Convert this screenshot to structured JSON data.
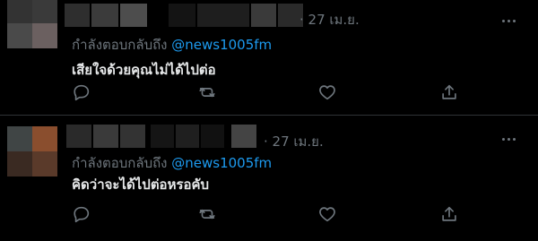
{
  "colors": {
    "background": "#000000",
    "muted": "#6e767d",
    "accent": "#1d9bf0",
    "text": "#e7e9ea",
    "divider": "#2f3336"
  },
  "tweets": [
    {
      "timestamp": "· 27 เม.ย.",
      "reply_prefix": "กำลังตอบกลับถึง ",
      "reply_to": "@news1005fm",
      "text": "เสียใจด้วยคุณไม่ได้ไปต่อ",
      "avatar_blur_colors": [
        "#333333",
        "#3a3a3a",
        "#4a4a4a",
        "#6b6060"
      ],
      "name_blur_colors": [
        "#2e2e2e",
        "#3b3b3b",
        "#4d4d4d",
        "#2a2a2a"
      ],
      "handle_blur_colors": [
        "#141414",
        "#1e1e1e",
        "#333333",
        "#444444",
        "#222222"
      ],
      "icons": [
        "reply-icon",
        "retweet-icon",
        "like-icon",
        "share-icon"
      ]
    },
    {
      "timestamp": "· 27 เม.ย.",
      "reply_prefix": "กำลังตอบกลับถึง ",
      "reply_to": "@news1005fm",
      "text": "คิดว่าจะได้ไปต่อหรอคับ",
      "avatar_blur_colors": [
        "#404545",
        "#8a4e2e",
        "#3a2a22",
        "#5a3a2a"
      ],
      "name_blur_colors": [
        "#2a2a2a",
        "#3a3a3a",
        "#333333",
        "#2a2a2a"
      ],
      "handle_blur_colors": [
        "#151515",
        "#1f1f1f",
        "#111111",
        "#444444"
      ],
      "icons": [
        "reply-icon",
        "retweet-icon",
        "like-icon",
        "share-icon"
      ]
    }
  ]
}
